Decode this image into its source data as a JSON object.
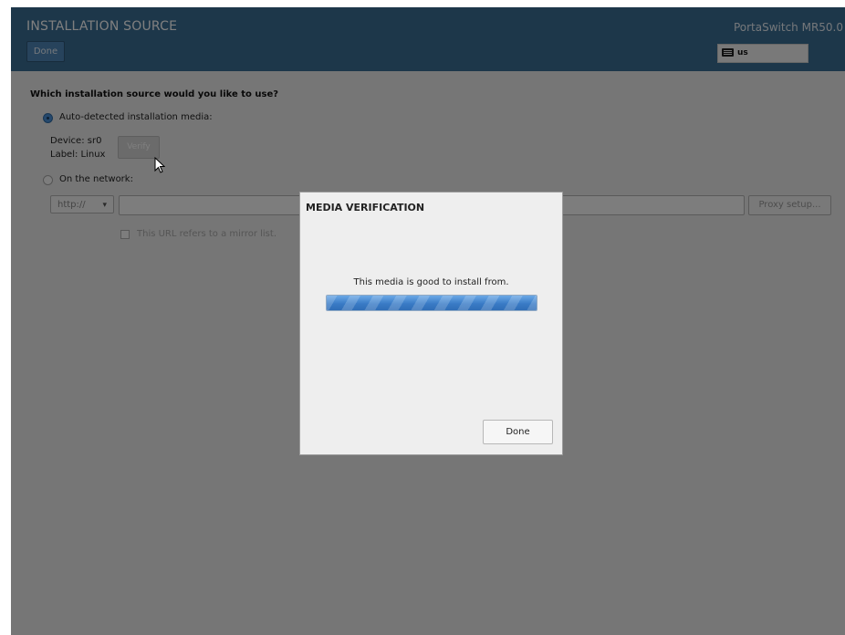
{
  "header": {
    "title": "INSTALLATION SOURCE",
    "done_label": "Done",
    "product": "PortaSwitch MR50.0",
    "keyboard_layout": "us"
  },
  "source": {
    "question": "Which installation source would you like to use?",
    "auto_option_label": "Auto-detected installation media:",
    "auto_selected": true,
    "device_text": "Device: sr0",
    "label_text": "Label: Linux",
    "verify_label": "Verify",
    "network_option_label": "On the network:",
    "protocol_value": "http://",
    "url_value": "",
    "proxy_label": "Proxy setup...",
    "mirror_label": "This URL refers to a mirror list."
  },
  "dialog": {
    "title": "MEDIA VERIFICATION",
    "message": "This media is good to install from.",
    "progress": 1.0,
    "done_label": "Done"
  },
  "colors": {
    "header_bg": "#3b6e95",
    "accent": "#4a90d9",
    "overlay": "rgba(0,0,0,0.5)"
  },
  "icons": {
    "keyboard": "keyboard-icon",
    "dropdown": "chevron-down-icon",
    "cursor": "mouse-pointer-icon"
  }
}
